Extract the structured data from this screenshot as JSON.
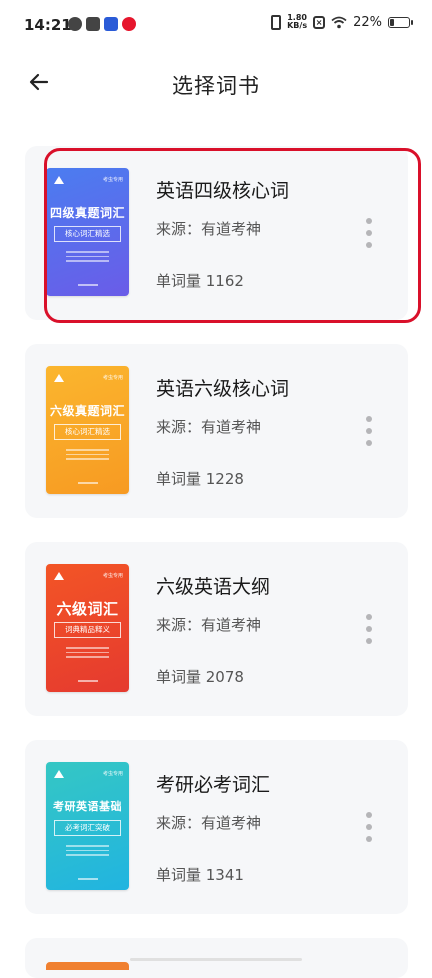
{
  "status_bar": {
    "time": "14:21",
    "net_speed_value": "1.80",
    "net_speed_unit": "KB/s",
    "battery": "22%"
  },
  "header": {
    "title": "选择词书",
    "back_icon": "arrow-left-icon"
  },
  "books": [
    {
      "title": "英语四级核心词",
      "source": "来源：有道考神",
      "count": "单词量  1162",
      "cover": {
        "title": "四级真题词汇",
        "subtitle": "核心词汇精选",
        "brand": "考虫专用",
        "color_top": "#4b7df0",
        "color_bottom": "#6a5ce8"
      },
      "selected": true
    },
    {
      "title": "英语六级核心词",
      "source": "来源：有道考神",
      "count": "单词量  1228",
      "cover": {
        "title": "六级真题词汇",
        "subtitle": "核心词汇精选",
        "brand": "考虫专用",
        "color_top": "#fbb62e",
        "color_bottom": "#f79a22"
      },
      "selected": false
    },
    {
      "title": "六级英语大纲",
      "source": "来源：有道考神",
      "count": "单词量  2078",
      "cover": {
        "title": "六级词汇",
        "subtitle": "词典精品释义",
        "brand": "考虫专用",
        "color_top": "#f35526",
        "color_bottom": "#e53a2f"
      },
      "selected": false
    },
    {
      "title": "考研必考词汇",
      "source": "来源：有道考神",
      "count": "单词量  1341",
      "cover": {
        "title": "考研英语基础",
        "subtitle": "必考词汇突破",
        "brand": "考虫专用",
        "color_top": "#35c7c4",
        "color_bottom": "#21b4e0"
      },
      "selected": false
    }
  ],
  "colors": {
    "selected_outline": "#d9102a",
    "card_bg": "#f6f7f9"
  }
}
